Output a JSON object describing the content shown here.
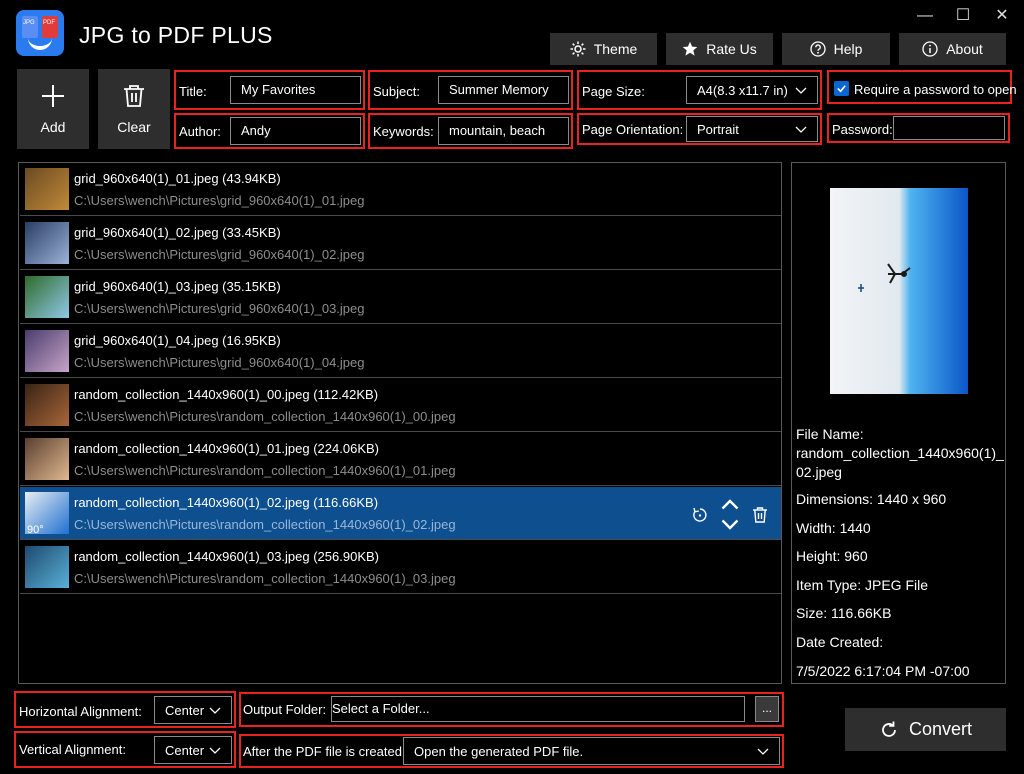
{
  "app": {
    "title": "JPG to PDF PLUS",
    "icon_labels": [
      "JPG",
      "PDF"
    ]
  },
  "window": {
    "minimize": "—",
    "maximize": "☐",
    "close": "✕"
  },
  "header": {
    "theme_label": "Theme",
    "rate_label": "Rate Us",
    "help_label": "Help",
    "about_label": "About"
  },
  "toolbar": {
    "add_label": "Add",
    "clear_label": "Clear"
  },
  "meta": {
    "title_label": "Title:",
    "title_value": "My Favorites",
    "author_label": "Author:",
    "author_value": "Andy",
    "subject_label": "Subject:",
    "subject_value": "Summer Memory",
    "keywords_label": "Keywords:",
    "keywords_value": "mountain, beach",
    "page_size_label": "Page Size:",
    "page_size_value": "A4(8.3 x11.7 in)",
    "orientation_label": "Page Orientation:",
    "orientation_value": "Portrait",
    "require_password_label": "Require a password to open",
    "require_password_checked": true,
    "password_label": "Password:",
    "password_value": ""
  },
  "files": [
    {
      "title": "grid_960x640(1)_01.jpeg (43.94KB)",
      "path": "C:\\Users\\wench\\Pictures\\grid_960x640(1)_01.jpeg",
      "colors": [
        "#6b4a22",
        "#c08a3a"
      ]
    },
    {
      "title": "grid_960x640(1)_02.jpeg (33.45KB)",
      "path": "C:\\Users\\wench\\Pictures\\grid_960x640(1)_02.jpeg",
      "colors": [
        "#2b3f66",
        "#9cb2d6"
      ]
    },
    {
      "title": "grid_960x640(1)_03.jpeg (35.15KB)",
      "path": "C:\\Users\\wench\\Pictures\\grid_960x640(1)_03.jpeg",
      "colors": [
        "#2f6b2a",
        "#8fc8e8"
      ]
    },
    {
      "title": "grid_960x640(1)_04.jpeg (16.95KB)",
      "path": "C:\\Users\\wench\\Pictures\\grid_960x640(1)_04.jpeg",
      "colors": [
        "#4a3d6e",
        "#c7a5c8"
      ]
    },
    {
      "title": "random_collection_1440x960(1)_00.jpeg (112.42KB)",
      "path": "C:\\Users\\wench\\Pictures\\random_collection_1440x960(1)_00.jpeg",
      "colors": [
        "#3a2414",
        "#a8663a"
      ]
    },
    {
      "title": "random_collection_1440x960(1)_01.jpeg (224.06KB)",
      "path": "C:\\Users\\wench\\Pictures\\random_collection_1440x960(1)_01.jpeg",
      "colors": [
        "#5a4030",
        "#e0b890"
      ]
    },
    {
      "title": "random_collection_1440x960(1)_02.jpeg (116.66KB)",
      "path": "C:\\Users\\wench\\Pictures\\random_collection_1440x960(1)_02.jpeg",
      "colors": [
        "#e8eef2",
        "#1f6fd0"
      ],
      "selected": true,
      "rotation": "90°"
    },
    {
      "title": "random_collection_1440x960(1)_03.jpeg (256.90KB)",
      "path": "C:\\Users\\wench\\Pictures\\random_collection_1440x960(1)_03.jpeg",
      "colors": [
        "#1d4a6e",
        "#5ab0d8"
      ]
    }
  ],
  "preview": {
    "file_name_label": "File Name:",
    "file_name_line1": "random_collection_1440x960(1)_",
    "file_name_line2": "02.jpeg",
    "dimensions": "Dimensions: 1440 x 960",
    "width": "Width: 1440",
    "height": "Height: 960",
    "item_type": "Item Type: JPEG File",
    "size": "Size: 116.66KB",
    "date_label": "Date Created:",
    "date_value": "7/5/2022 6:17:04 PM -07:00"
  },
  "bottom": {
    "h_align_label": "Horizontal Alignment:",
    "h_align_value": "Center",
    "v_align_label": "Vertical Alignment:",
    "v_align_value": "Center",
    "output_label": "Output Folder:",
    "output_placeholder": "Select a Folder...",
    "browse_label": "...",
    "after_label": "After the PDF file is created:",
    "after_value": "Open the generated PDF file."
  },
  "convert": {
    "label": "Convert"
  },
  "colors": {
    "accent": "#e8231f",
    "selection": "#0e4f8f",
    "button_bg": "#2e2e2e",
    "checkbox": "#0a66d0"
  }
}
